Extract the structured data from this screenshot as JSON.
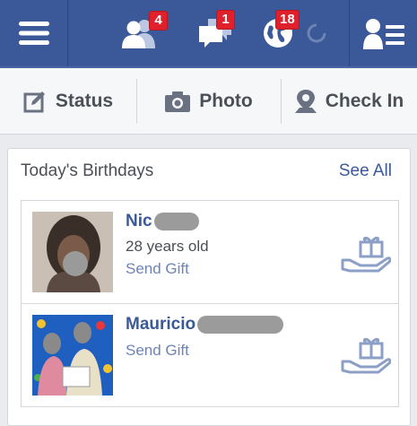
{
  "topbar": {
    "friend_requests_count": "4",
    "messages_count": "1",
    "notifications_count": "18"
  },
  "actions": {
    "status_label": "Status",
    "photo_label": "Photo",
    "checkin_label": "Check In"
  },
  "birthdays": {
    "title": "Today's Birthdays",
    "see_all": "See All",
    "people": [
      {
        "name": "Nic",
        "age": "28 years old",
        "send_gift": "Send Gift"
      },
      {
        "name": "Mauricio",
        "send_gift": "Send Gift"
      }
    ]
  },
  "colors": {
    "brand": "#3b5998",
    "badge": "#e0202b",
    "link_light": "#6d84b4"
  },
  "icons": [
    "menu-icon",
    "friend-requests-icon",
    "messages-icon",
    "notifications-globe-icon",
    "loading-spinner-icon",
    "friends-list-icon",
    "edit-status-icon",
    "camera-icon",
    "location-pin-icon",
    "gift-icon"
  ]
}
